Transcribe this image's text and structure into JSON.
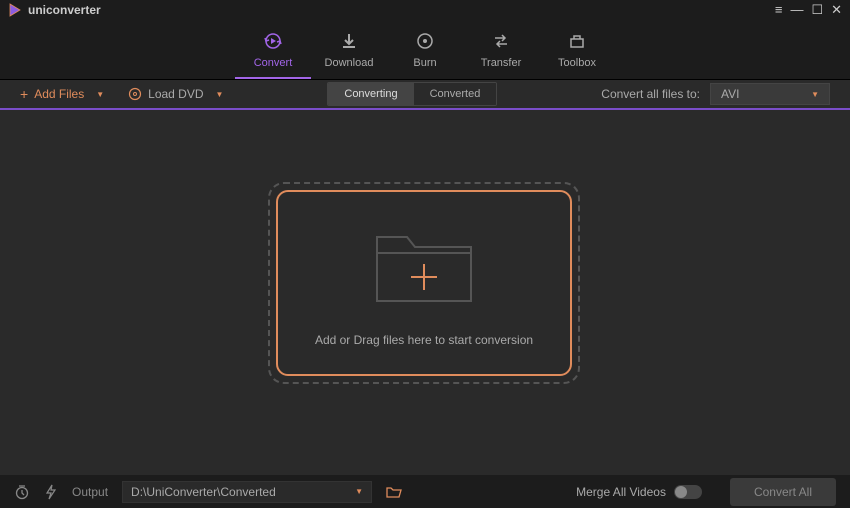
{
  "app": {
    "name": "uniconverter"
  },
  "nav": {
    "items": [
      {
        "label": "Convert"
      },
      {
        "label": "Download"
      },
      {
        "label": "Burn"
      },
      {
        "label": "Transfer"
      },
      {
        "label": "Toolbox"
      }
    ]
  },
  "toolbar": {
    "add_files": "Add Files",
    "load_dvd": "Load DVD",
    "tabs": {
      "converting": "Converting",
      "converted": "Converted"
    },
    "convert_all_label": "Convert all files to:",
    "convert_format": "AVI"
  },
  "dropzone": {
    "text": "Add or Drag files here to start conversion"
  },
  "footer": {
    "output_label": "Output",
    "output_path": "D:\\UniConverter\\Converted",
    "merge_label": "Merge All Videos",
    "convert_all": "Convert All"
  }
}
